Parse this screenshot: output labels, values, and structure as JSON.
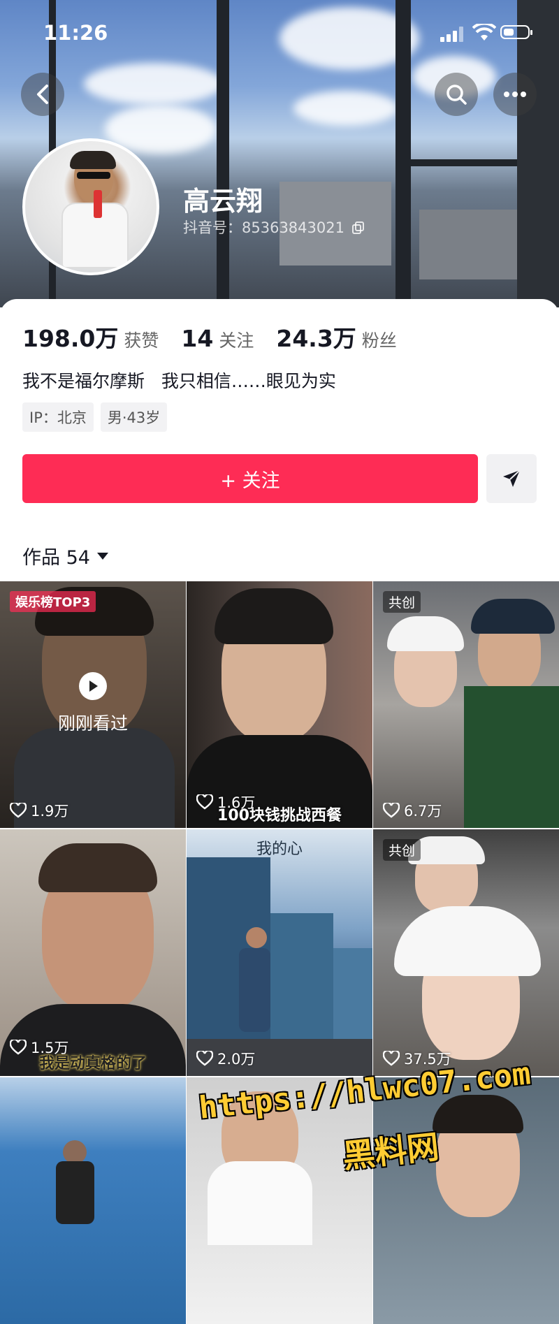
{
  "status_bar": {
    "time": "11:26"
  },
  "profile": {
    "name": "高云翔",
    "douyin_id": "抖音号：85363843021",
    "stats": [
      {
        "value": "198.0万",
        "label": "获赞"
      },
      {
        "value": "14",
        "label": "关注"
      },
      {
        "value": "24.3万",
        "label": "粉丝"
      }
    ],
    "bio": "我不是福尔摩斯   我只相信……眼见为实",
    "tags": [
      "IP：北京",
      "男·43岁"
    ]
  },
  "actions": {
    "follow_label": "+ 关注"
  },
  "works": {
    "label": "作品 54"
  },
  "videos": [
    {
      "likes": "1.9万",
      "badge": "娱乐榜TOP3",
      "overlay": "刚刚看过"
    },
    {
      "likes": "1.6万",
      "caption": "100块钱挑战西餐"
    },
    {
      "likes": "6.7万",
      "badge": "共创"
    },
    {
      "likes": "1.5万",
      "caption": "我是动真格的了"
    },
    {
      "likes": "2.0万",
      "caption": "我的心"
    },
    {
      "likes": "37.5万",
      "badge": "共创"
    },
    {
      "likes": ""
    },
    {
      "likes": ""
    },
    {
      "likes": ""
    }
  ],
  "watermark": {
    "url": "https://hlwc07.com",
    "name": "黑料网"
  },
  "colors": {
    "accent": "#fe2c55",
    "text": "#161823"
  }
}
